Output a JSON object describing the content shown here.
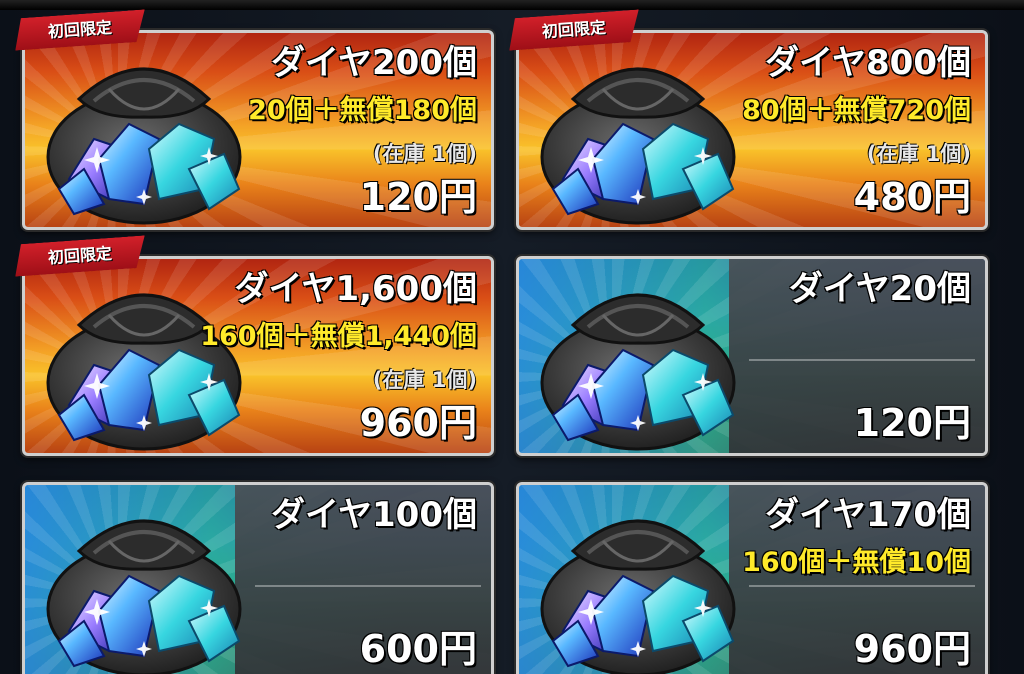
{
  "ribbon_label": "初回限定",
  "cards": [
    {
      "title": "ダイヤ200個",
      "breakdown": "20個＋無償180個",
      "stock": "(在庫 1個)",
      "price": "120円",
      "limited": true,
      "theme": "gold"
    },
    {
      "title": "ダイヤ800個",
      "breakdown": "80個＋無償720個",
      "stock": "(在庫 1個)",
      "price": "480円",
      "limited": true,
      "theme": "gold"
    },
    {
      "title": "ダイヤ1,600個",
      "breakdown": "160個＋無償1,440個",
      "stock": "(在庫 1個)",
      "price": "960円",
      "limited": true,
      "theme": "gold"
    },
    {
      "title": "ダイヤ20個",
      "breakdown": "",
      "stock": "",
      "price": "120円",
      "limited": false,
      "theme": "blue"
    },
    {
      "title": "ダイヤ100個",
      "breakdown": "",
      "stock": "",
      "price": "600円",
      "limited": false,
      "theme": "blue"
    },
    {
      "title": "ダイヤ170個",
      "breakdown": "160個＋無償10個",
      "stock": "",
      "price": "960円",
      "limited": false,
      "theme": "blue"
    }
  ],
  "colors": {
    "gold_top": "#b12511",
    "gold_mid": "#f9c22a",
    "blue_top": "#1f56b8",
    "breakdown_text": "#ffea2a",
    "ribbon": "#d2202a"
  },
  "icons": [
    "diamond-bag-icon"
  ]
}
